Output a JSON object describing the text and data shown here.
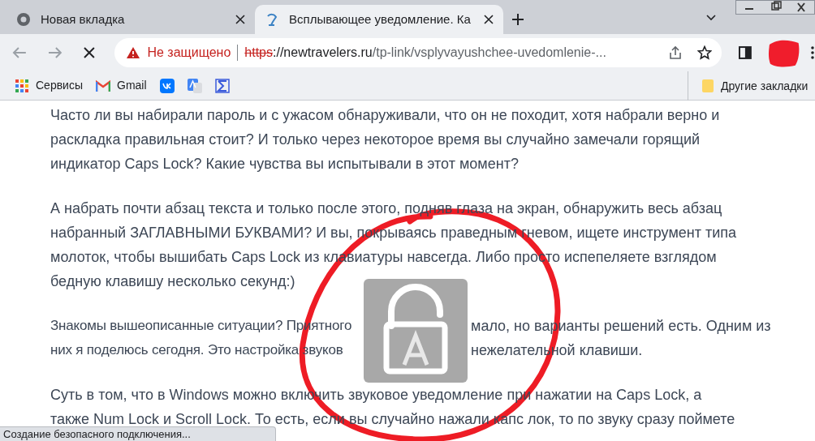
{
  "tabs": [
    {
      "title": "Новая вкладка",
      "selected": false,
      "kind": "chrome"
    },
    {
      "title": "Всплывающее уведомление. Ка",
      "selected": true,
      "kind": "site"
    }
  ],
  "toolbar": {
    "security": "Не защищено",
    "url_scheme": "https",
    "url_rest": "://newtravelers.ru",
    "url_path": "/tp-link/vsplyvayushchee-uvedomlenie-...",
    "loading": true
  },
  "bookmarks": [
    {
      "label": "Сервисы",
      "kind": "apps"
    },
    {
      "label": "Gmail",
      "kind": "gmail"
    },
    {
      "kind": "vk"
    },
    {
      "kind": "translate"
    },
    {
      "kind": "sigma"
    }
  ],
  "other_bookmarks": "Другие закладки",
  "paragraphs": [
    [
      "Часто ли вы набирали пароль и с ужасом обнаруживали, что он не походит, хотя набрали верно и",
      "раскладка правильная стоит? И только через некоторое время вы случайно замечали горящий",
      "индикатор Caps Lock? Какие чувства вы испытывали в этот момент?"
    ],
    [
      "А набрать почти абзац текста и только после этого, подняв глаза на экран, обнаружить весь абзац",
      "набранный ЗАГЛАВНЫМИ БУКВАМИ? И вы, покрываясь праведным гневом, ищете инструмент типа",
      "молоток, чтобы вышибать Caps Lock из клавиатуры навсегда. Либо просто испепеляете взглядом",
      "бедную клавишу несколько секунд:)"
    ],
    [
      {
        "segments": [
          "Знакомы вышеописанные ситуации? Приятного",
          "мало, но варианты решений есть. Одним из"
        ]
      },
      {
        "segments": [
          "них я поделюсь сегодня. Это настройка звуков",
          "нежелательной клавиши."
        ]
      }
    ],
    [
      "Суть в том, что в Windows можно включить звуковое уведомление при нажатии на Caps Lock, а",
      "также Num Lock и Scroll Lock. То есть, если вы случайно нажали капс лок, то по звуку сразу поймете"
    ]
  ],
  "status_bar": "Создание безопасного подключения..."
}
